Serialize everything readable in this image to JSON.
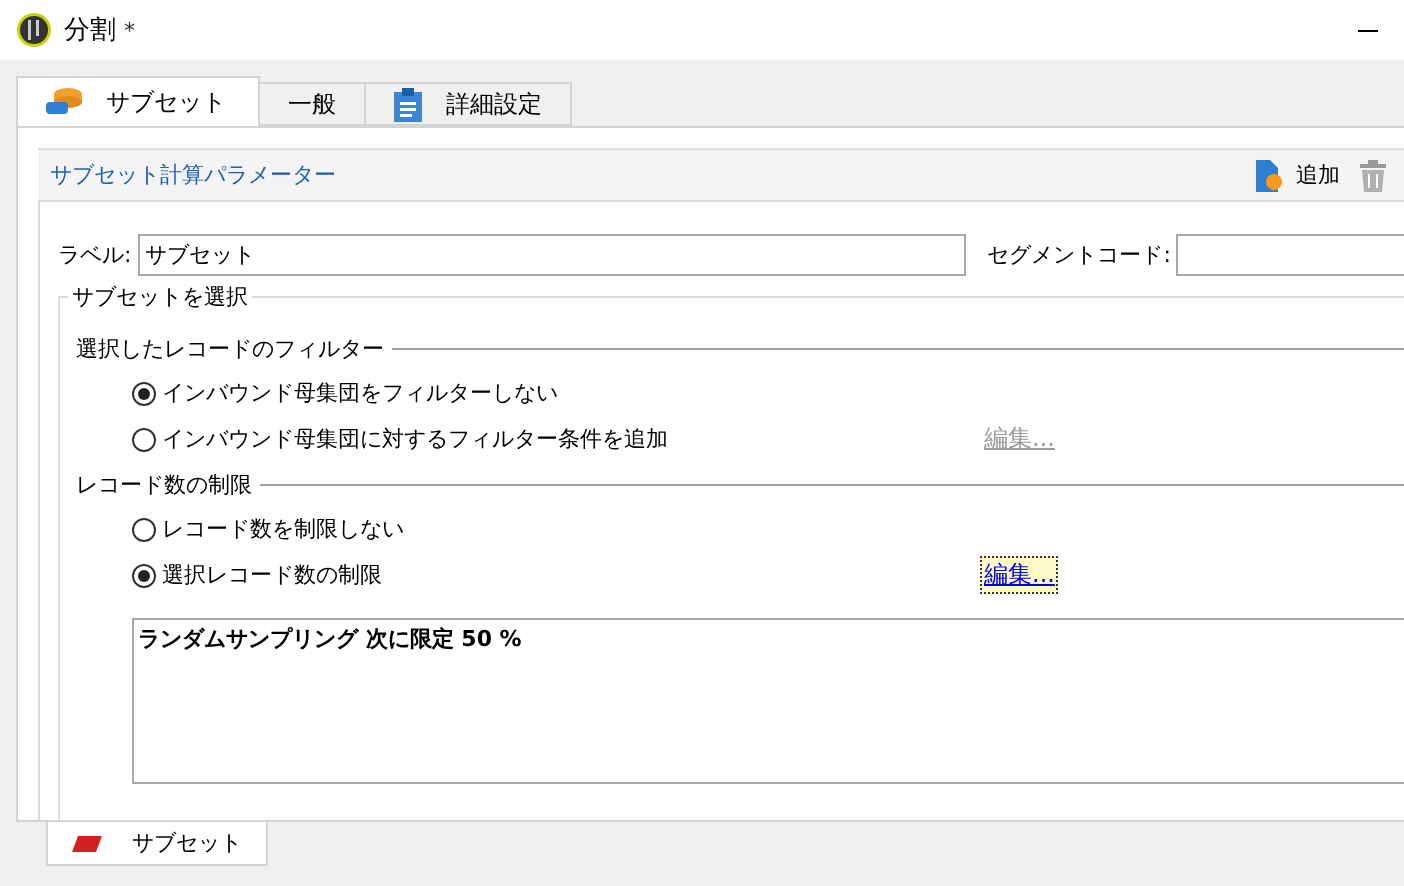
{
  "window": {
    "title": "分割",
    "modified_mark": "*"
  },
  "tabs": [
    {
      "label": "サブセット",
      "selected": true,
      "kind": "database"
    },
    {
      "label": "一般",
      "selected": false,
      "kind": "plain"
    },
    {
      "label": "詳細設定",
      "selected": false,
      "kind": "clipboard"
    }
  ],
  "section_header": {
    "title": "サブセット計算パラメーター",
    "actions": [
      {
        "kind": "add",
        "label": "追加"
      },
      {
        "kind": "delete"
      }
    ]
  },
  "fields": [
    {
      "label": "ラベル:",
      "value": "サブセット"
    },
    {
      "label": "セグメントコード:"
    }
  ],
  "group": {
    "title": "サブセットを選択",
    "sections": [
      {
        "title": "選択したレコードのフィルター",
        "options": [
          {
            "label": "インバウンド母集団をフィルターしない",
            "selected": true
          },
          {
            "label": "インバウンド母集団に対するフィルター条件を追加",
            "selected": false,
            "edit_link": {
              "label": "編集...",
              "disabled": true,
              "focused": false
            }
          }
        ]
      },
      {
        "title": "レコード数の制限",
        "options": [
          {
            "label": "レコード数を制限しない",
            "selected": false
          },
          {
            "label": "選択レコード数の制限",
            "selected": true,
            "edit_link": {
              "label": "編集...",
              "disabled": false,
              "focused": true
            }
          }
        ]
      }
    ],
    "summary": "ランダムサンプリング 次に限定 50 %"
  },
  "bottom_tabs": [
    {
      "label": "サブセット",
      "selected": true
    }
  ]
}
